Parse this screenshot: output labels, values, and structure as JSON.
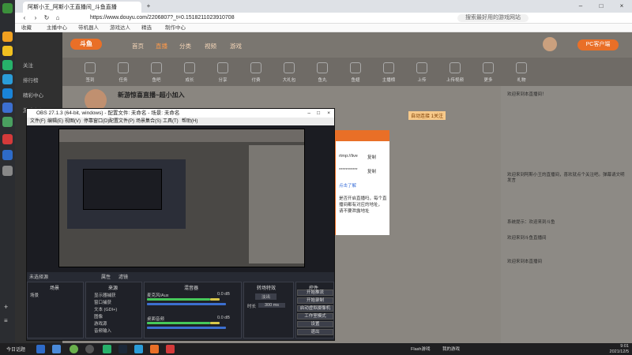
{
  "browser": {
    "tab_title": "阿斯小王_阿斯小王直播间_斗鱼直播",
    "url": "https://www.douyu.com/2206807?_t=0.1518211023910708",
    "search_placeholder": "搜索最好用的游戏网站",
    "bookmarks": [
      "收藏",
      "主播中心",
      "带机器人",
      "游戏达人",
      "精选",
      "制作中心"
    ]
  },
  "site": {
    "logo": "斗鱼",
    "nav": [
      "首页",
      "直播",
      "分类",
      "视频",
      "游戏"
    ],
    "pc_button": "PC客户端",
    "side_items": [
      "关注",
      "排行榜",
      "精彩中心",
      "游戏中心"
    ],
    "icon_row": [
      "签到",
      "任务",
      "鱼吧",
      "成长",
      "分享",
      "付费",
      "大礼包",
      "鱼丸",
      "鱼翅",
      "主播榜",
      "上传",
      "上传视频",
      "更多",
      "礼物"
    ],
    "room_title": "新游惊喜直播~超小加入",
    "tag_badge": "自动连接 1关注",
    "chat": [
      "欢迎来到本直播间！",
      "欢迎来到阿斯小王的直播间，喜欢就点个关注吧。弹幕请文明发言",
      "系统提示：欢迎来到斗鱼",
      "欢迎来到斗鱼直播间",
      "欢迎来到本直播间"
    ]
  },
  "obs": {
    "title": "OBS 27.1.3 (64-bit, windows) - 配置文件: 未命名 - 场景: 未命名",
    "menu": [
      "文件(F)",
      "编辑(E)",
      "视图(V)",
      "停靠窗口(D)",
      "配置文件(P)",
      "场景集合(S)",
      "工具(T)",
      "帮助(H)"
    ],
    "status": "未选择源",
    "props_btn": "属性",
    "filters_btn": "滤镜",
    "docks": [
      "场景",
      "来源",
      "混音器",
      "转场特效",
      "控件"
    ],
    "scene": "场景",
    "sources": [
      "显示器捕获",
      "窗口捕获",
      "文本 (GDI+)",
      "图像",
      "游戏源",
      "音频输入"
    ],
    "mixer": [
      {
        "name": "桌面音频",
        "level": "0.0 dB"
      },
      {
        "name": "麦克风/Aux",
        "level": "0.0 dB"
      }
    ],
    "transition": "淡出",
    "duration_label": "时长",
    "duration": "300 ms",
    "controls": [
      "开始推流",
      "开始录制",
      "启动虚拟摄像机",
      "工作室模式",
      "设置",
      "退出"
    ]
  },
  "dialog": {
    "rows": [
      "rtmp://live",
      "复制",
      "***********",
      "复制",
      "点击了解",
      "是否开启直播吗，每个直",
      "播间都有对应的地址，",
      "请不要泄露地址"
    ]
  },
  "taskbar": {
    "news": "今日话题",
    "tray": [
      "Flash游戏",
      "我的游戏"
    ],
    "time": "9:01",
    "date": "2021/12/5"
  },
  "colors": {
    "accent": "#e96f27",
    "obs_bg": "#2b2e38"
  }
}
